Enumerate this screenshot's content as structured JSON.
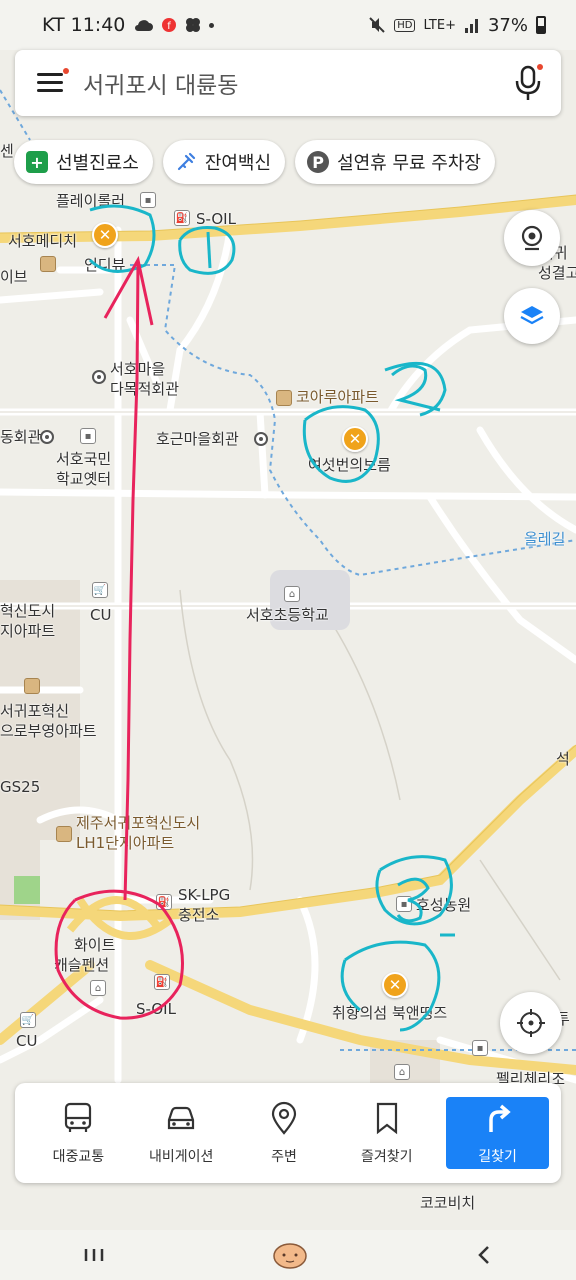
{
  "status_bar": {
    "carrier_time": "KT 11:40",
    "network": "LTE+",
    "battery": "37%",
    "hd_badge": "HD"
  },
  "search": {
    "placeholder": "서귀포시 대륜동",
    "menu_icon": "menu-icon",
    "mic_icon": "mic-icon"
  },
  "chips": [
    {
      "label": "선별진료소",
      "icon": "plus-icon",
      "color": "#1e9e4a"
    },
    {
      "label": "잔여백신",
      "icon": "syringe-icon",
      "color": "#3d7ee0"
    },
    {
      "label": "설연휴 무료 주차장",
      "icon": "parking-icon",
      "color": "#555555"
    }
  ],
  "map": {
    "labels": {
      "edge_1": "센",
      "flower_roller": "플레이롤러",
      "s_oil_1": "S-OIL",
      "seoho_medi": "서호메디치",
      "indi_view": "인디뷰",
      "edge_2": "이브",
      "seoho_maeul_1": "서호마을",
      "seoho_maeul_2": "다목적회관",
      "koara": "코아루아파트",
      "hall_left": "동회관",
      "hogeun": "호근마을회관",
      "seoho_school_old_1": "서호국민",
      "seoho_school_old_2": "학교옛터",
      "yeoseot": "여섯번의보름",
      "olle": "올레길",
      "cu_1": "CU",
      "seoho_elem": "서호초등학교",
      "new_city_1": "혁신도시",
      "new_city_2": "지아파트",
      "seogwipo_1": "서귀포혁신",
      "seogwipo_2": "으로부영아파트",
      "gs25": "GS25",
      "jeju_lh_1": "제주서귀포혁신도시",
      "jeju_lh_2": "LH1단지아파트",
      "sk_lpg_1": "SK-LPG",
      "sk_lpg_2": "충전소",
      "white_1": "화이트",
      "white_2": "캐슬펜션",
      "s_oil_2": "S-OIL",
      "cu_2": "CU",
      "hoseong": "호성농원",
      "chwihyang": "취향의섬 북앤띵즈",
      "pelly": "펠리체리조",
      "edge_right_1": "서귀",
      "edge_right_2": "성결고",
      "edge_right_3": "석",
      "edge_right_4": "투",
      "cocobichi": "코코비치"
    },
    "annotations": [
      "1",
      "2",
      "3"
    ]
  },
  "bottom_nav": [
    {
      "label": "대중교통",
      "icon": "bus-icon"
    },
    {
      "label": "내비게이션",
      "icon": "car-icon"
    },
    {
      "label": "주변",
      "icon": "location-pin-icon"
    },
    {
      "label": "즐겨찾기",
      "icon": "bookmark-icon"
    },
    {
      "label": "길찾기",
      "icon": "turn-arrow-icon"
    }
  ],
  "colors": {
    "primary": "#1a82f7",
    "annotation_cyan": "#19b6c9",
    "annotation_pink": "#e8235c",
    "road_yellow": "#f5d77a",
    "marker_orange": "#f0a31b"
  }
}
